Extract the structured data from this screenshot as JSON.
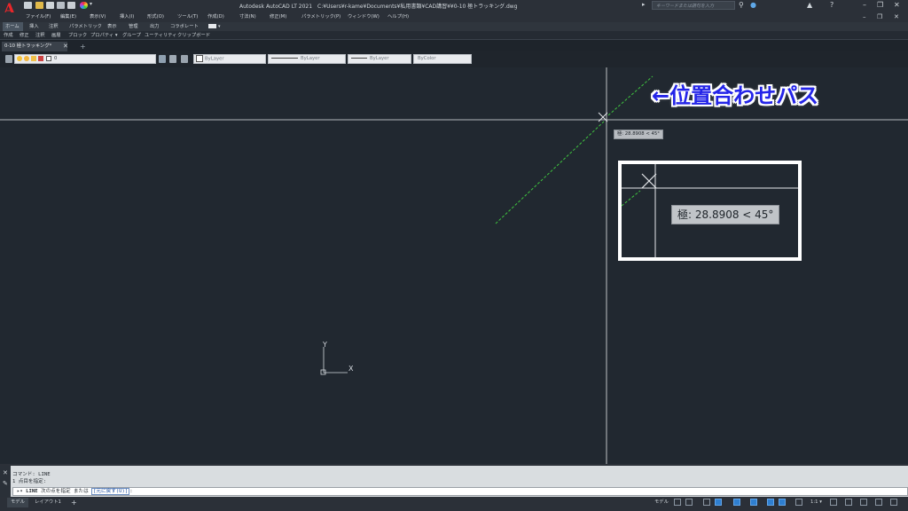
{
  "titlebar": {
    "logo": "A",
    "title": "Autodesk AutoCAD LT 2021　C:¥Users¥r-kame¥Documents¥私用書類¥CAD講習¥¥0-10 極トラッキング.dwg",
    "search_placeholder": "キーワードまたは語句を入力",
    "min": "–",
    "restore": "❐",
    "close": "✕"
  },
  "menu": [
    "ファイル(F)",
    "編集(E)",
    "表示(V)",
    "挿入(I)",
    "形式(O)",
    "ツール(T)",
    "作成(D)",
    "寸法(N)",
    "修正(M)",
    "パラメトリック(P)",
    "ウィンドウ(W)",
    "ヘルプ(H)"
  ],
  "ribbon_tabs": [
    "ホーム",
    "挿入",
    "注釈",
    "パラメトリック",
    "表示",
    "管理",
    "出力",
    "コラボレート"
  ],
  "ribbon_panels": [
    "作成",
    "修正",
    "注釈",
    "画層",
    "ブロック",
    "プロパティ ▾",
    "グループ",
    "ユーティリティ",
    "クリップボード"
  ],
  "doc_tab": {
    "label": "0-10 極トラッキング*",
    "close": "✕",
    "add": "+"
  },
  "layer_name": "0",
  "props": {
    "color": "ByLayer",
    "linetype": "ByLayer",
    "lineweight": "ByLayer",
    "plotstyle": "ByColor"
  },
  "annotation": "←位置合わせパス",
  "tooltip_small": "極: 28.8908 < 45°",
  "tooltip_big": "極: 28.8908 < 45°",
  "ucs": {
    "x": "X",
    "y": "Y"
  },
  "command": {
    "history": [
      "コマンド: LINE",
      "1 点目を指定:"
    ],
    "input_cmd": "LINE",
    "input_text": "次の点を指定 または",
    "input_option": "[元に戻す(U)]",
    "input_tail": ":"
  },
  "status": {
    "tab_model": "モデル",
    "tab_layout": "レイアウト1",
    "tab_add": "+",
    "model_label": "モデル",
    "scale": "1:1 ▾"
  },
  "colors": {
    "background": "#212830",
    "tracking_line": "#3fc43f",
    "annotation": "#2424e8"
  }
}
